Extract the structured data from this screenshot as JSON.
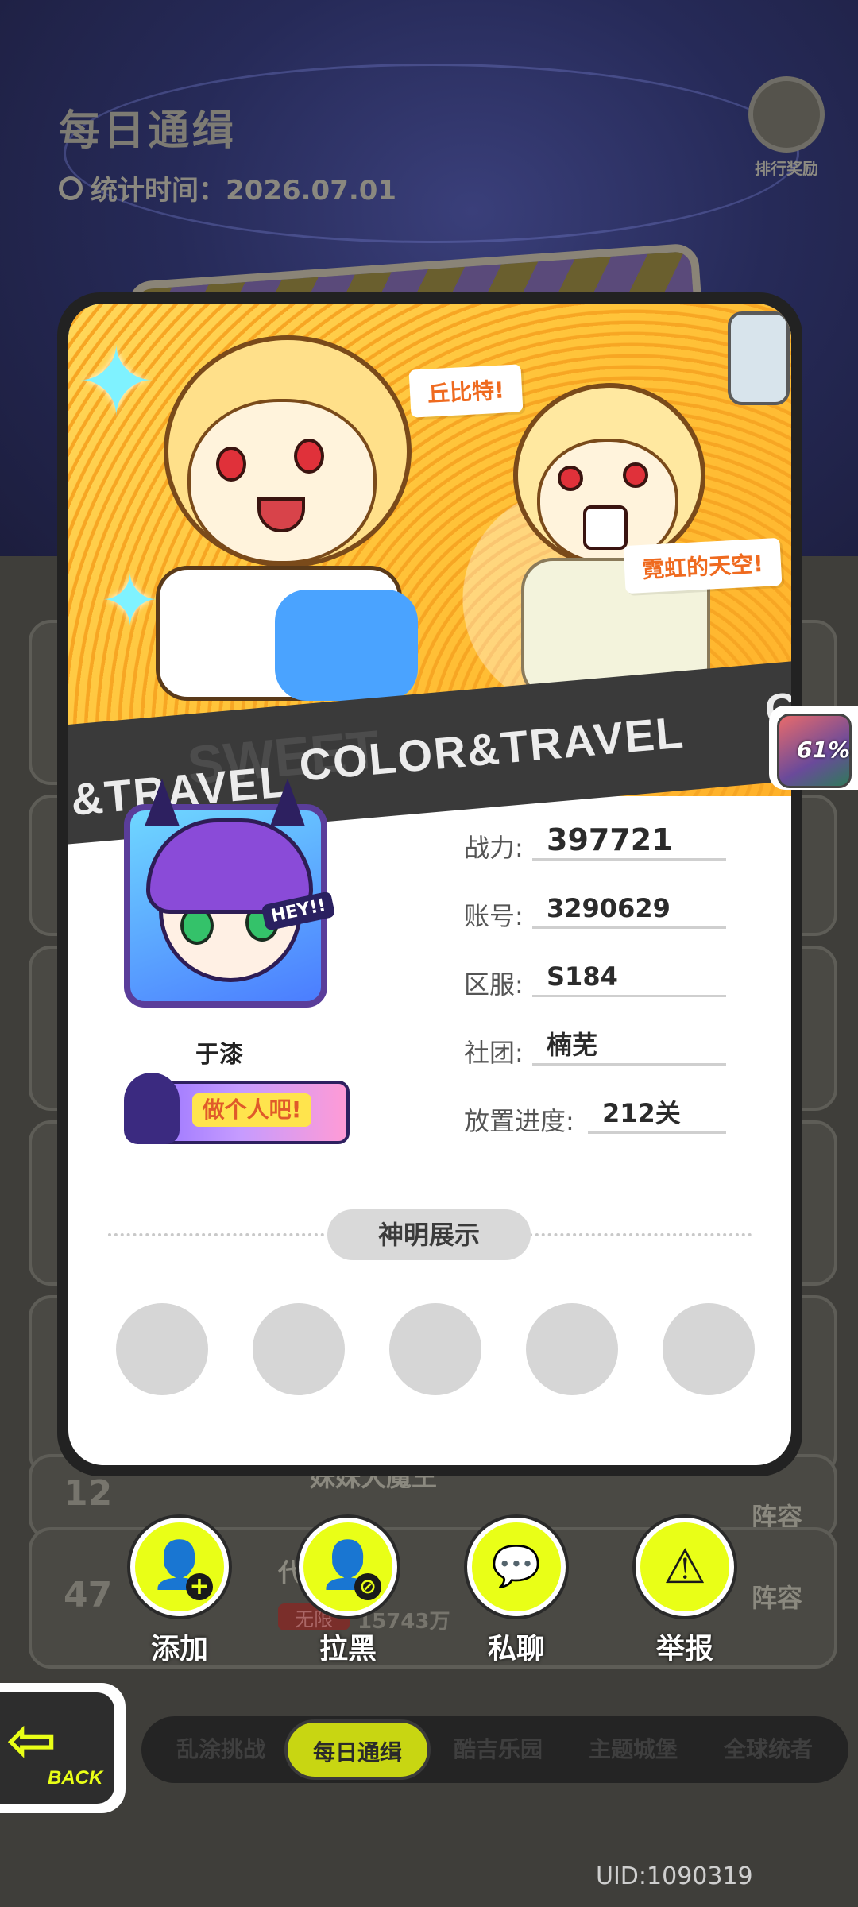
{
  "background": {
    "title": "每日通缉",
    "stat_time": "统计时间：2026.07.01",
    "rank_reward": "排行奖励",
    "rows": [
      {
        "rank": "12",
        "name": "妹妹大魔王",
        "team_link": "阵容"
      },
      {
        "rank": "47",
        "name": "代  dan",
        "tag": "无限",
        "score": "15743万",
        "team_link": "阵容"
      }
    ]
  },
  "card": {
    "banner": {
      "bubble_left": "丘比特!",
      "bubble_right": "霓虹的天空!",
      "band_text_main": "COLOR&TRAVEL",
      "band_text_left": "&TRAVEL",
      "band_text_right": "CO"
    },
    "player": {
      "nickname": "于漆",
      "title_badge": "做个人吧!",
      "avatar_sticker": "HEY!!"
    },
    "fields": [
      {
        "label": "战力:",
        "value": "397721"
      },
      {
        "label": "账号:",
        "value": "3290629"
      },
      {
        "label": "区服:",
        "value": "S184"
      },
      {
        "label": "社团:",
        "value": "楠芜"
      },
      {
        "label": "放置进度:",
        "value": "212关"
      }
    ],
    "deity_section": {
      "title": "神明展示",
      "slots": 5
    }
  },
  "side_badge": {
    "percent": "61%"
  },
  "actions": [
    {
      "label": "添加",
      "icon": "add-friend-icon"
    },
    {
      "label": "拉黑",
      "icon": "block-user-icon"
    },
    {
      "label": "私聊",
      "icon": "chat-icon"
    },
    {
      "label": "举报",
      "icon": "report-warning-icon"
    }
  ],
  "back": {
    "label": "BACK"
  },
  "tabs": [
    {
      "label": "乱涂挑战",
      "active": false
    },
    {
      "label": "每日通缉",
      "active": true
    },
    {
      "label": "酷吉乐园",
      "active": false
    },
    {
      "label": "主题城堡",
      "active": false
    },
    {
      "label": "全球统者",
      "active": false
    }
  ],
  "uid": "UID:1090319",
  "colors": {
    "accent": "#e9ff17",
    "card_border": "#222222",
    "dim_overlay": "#3f3e3a"
  }
}
